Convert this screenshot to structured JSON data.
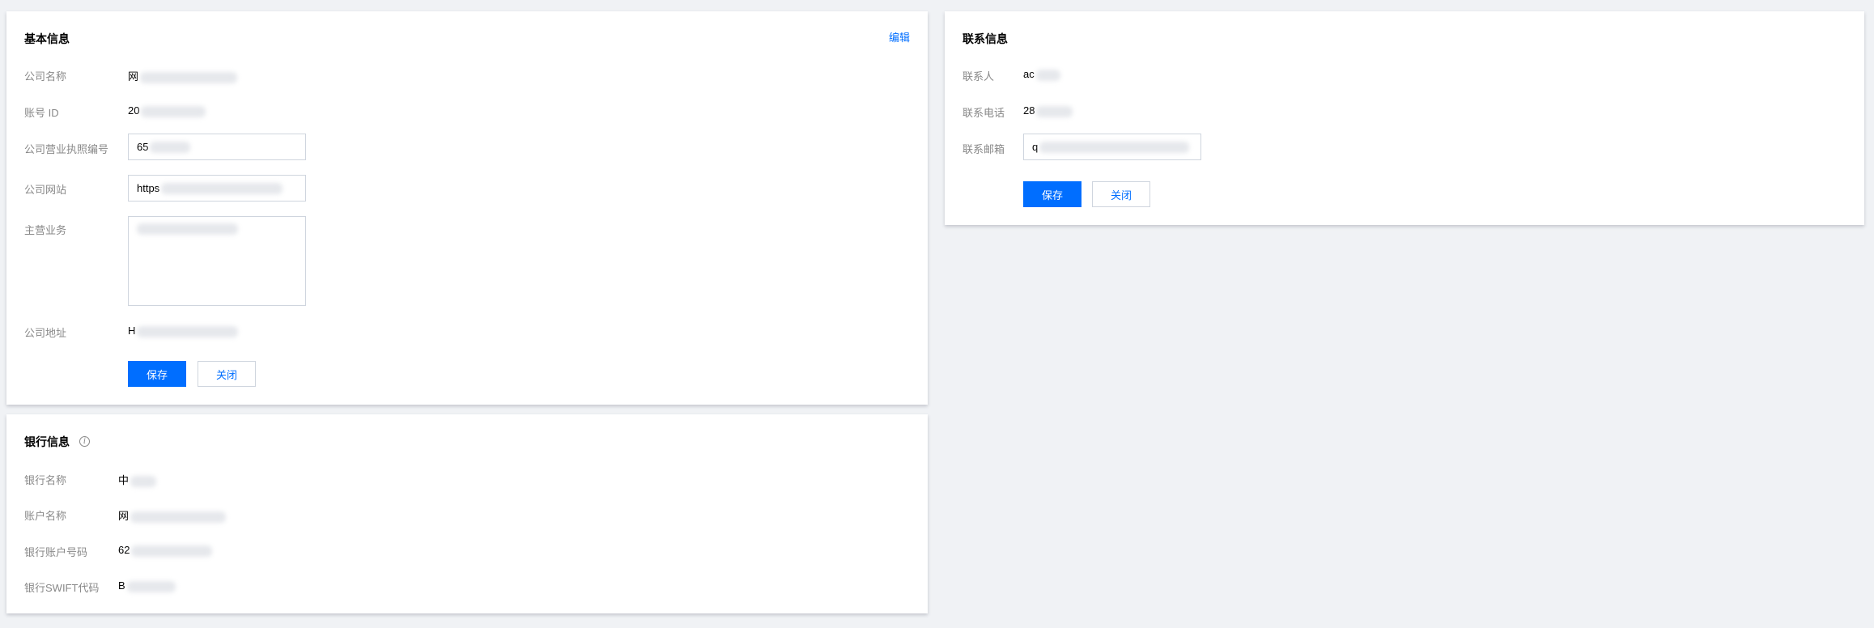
{
  "basic": {
    "title": "基本信息",
    "edit_label": "编辑",
    "fields": {
      "company_name": {
        "label": "公司名称",
        "value": "网"
      },
      "account_id": {
        "label": "账号 ID",
        "value": "20"
      },
      "license_no": {
        "label": "公司营业执照编号",
        "value": "65"
      },
      "website": {
        "label": "公司网站",
        "value": "https"
      },
      "business": {
        "label": "主营业务",
        "value": ""
      },
      "address": {
        "label": "公司地址",
        "value": "H"
      }
    },
    "save_label": "保存",
    "close_label": "关闭"
  },
  "bank": {
    "title": "银行信息",
    "info_icon": "i",
    "fields": {
      "bank_name": {
        "label": "银行名称",
        "value": "中"
      },
      "account_name": {
        "label": "账户名称",
        "value": "网"
      },
      "account_no": {
        "label": "银行账户号码",
        "value": "62"
      },
      "swift": {
        "label": "银行SWIFT代码",
        "value": "B"
      }
    }
  },
  "contact": {
    "title": "联系信息",
    "fields": {
      "person": {
        "label": "联系人",
        "value": "ac"
      },
      "phone": {
        "label": "联系电话",
        "value": "28"
      },
      "email": {
        "label": "联系邮箱",
        "value": "q"
      }
    },
    "save_label": "保存",
    "close_label": "关闭"
  },
  "colors": {
    "primary": "#006eff",
    "background": "#f0f2f5",
    "label": "#888888"
  }
}
